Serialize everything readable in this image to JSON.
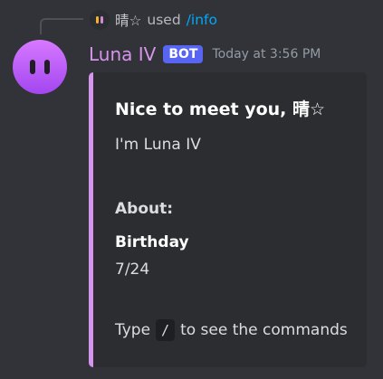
{
  "reply": {
    "user": "晴☆",
    "used_text": "used",
    "command": "/info"
  },
  "message": {
    "username": "Luna IV",
    "tag": "BOT",
    "timestamp": "Today at 3:56 PM",
    "accent_color": "#d794ec",
    "bot_tag_color": "#5865f2"
  },
  "embed": {
    "title": "Nice to meet you, 晴☆",
    "description": "I'm Luna IV",
    "about_label": "About:",
    "field_name": "Birthday",
    "field_value": "7/24",
    "footer_prefix": "Type",
    "footer_code": "/",
    "footer_suffix": "to see the commands"
  }
}
